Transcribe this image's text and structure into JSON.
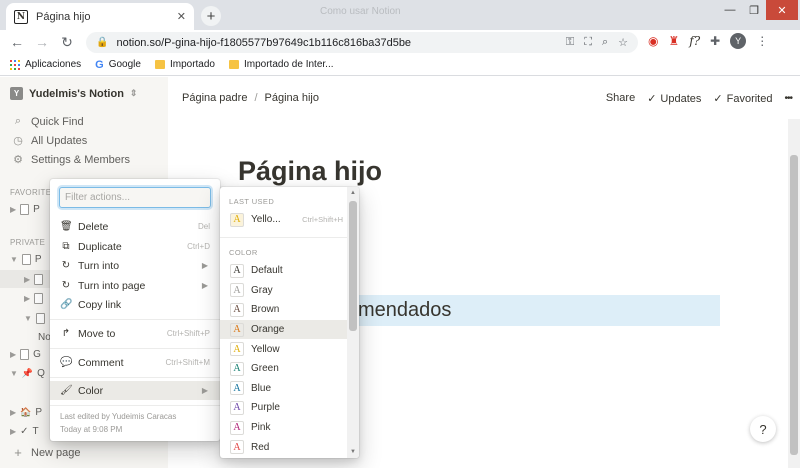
{
  "browser": {
    "tab_title": "Página hijo",
    "tab_favicon": "N",
    "tab_close": "✕",
    "new_tab": "+",
    "faint_text": "Como usar Notion",
    "url": "notion.so/P-gina-hijo-f1805577b97649c1b116c816ba37d5be",
    "win_min": "—",
    "win_max": "❐",
    "win_close": "✕",
    "avatar_letter": "Y",
    "bookmarks": [
      {
        "label": "Aplicaciones",
        "icon": "apps-icon"
      },
      {
        "label": "Google",
        "icon": "google-icon"
      },
      {
        "label": "Importado",
        "icon": "folder-icon"
      },
      {
        "label": "Importado de Inter...",
        "icon": "folder-icon"
      }
    ]
  },
  "sidebar": {
    "workspace": "Yudelmis's Notion",
    "workspace_letter": "Y",
    "items": [
      {
        "label": "Quick Find",
        "icon": "search-icon"
      },
      {
        "label": "All Updates",
        "icon": "clock-icon"
      },
      {
        "label": "Settings & Members",
        "icon": "gear-icon"
      }
    ],
    "favorites_label": "FAVORITES",
    "private_label": "PRIVATE",
    "row_letters": [
      "P",
      "P",
      "G",
      "Q",
      "P",
      "T"
    ],
    "row_trunc": "No",
    "new_page": "New page"
  },
  "topbar": {
    "crumb_parent": "Página padre",
    "crumb_sep": "/",
    "crumb_child": "Página hijo",
    "share": "Share",
    "updates": "Updates",
    "favorited": "Favorited",
    "more": "•••"
  },
  "page": {
    "title": "Página hijo",
    "callout_text": "mendados",
    "help": "?"
  },
  "menu": {
    "filter_placeholder": "Filter actions...",
    "items": [
      {
        "label": "Delete",
        "shortcut": "Del",
        "icon": "trash-icon"
      },
      {
        "label": "Duplicate",
        "shortcut": "Ctrl+D",
        "icon": "duplicate-icon"
      },
      {
        "label": "Turn into",
        "shortcut": "",
        "icon": "turn-into-icon"
      },
      {
        "label": "Turn into page",
        "shortcut": "",
        "icon": "turn-into-page-icon"
      },
      {
        "label": "Copy link",
        "shortcut": "",
        "icon": "link-icon"
      },
      {
        "label": "Move to",
        "shortcut": "Ctrl+Shift+P",
        "icon": "move-icon"
      },
      {
        "label": "Comment",
        "shortcut": "Ctrl+Shift+M",
        "icon": "comment-icon"
      },
      {
        "label": "Color",
        "shortcut": "",
        "icon": "paint-roller-icon"
      }
    ],
    "edited_by": "Last edited by Yudeimis Caracas",
    "edited_at": "Today at 9:08 PM"
  },
  "color_menu": {
    "last_used_label": "LAST USED",
    "last_used": {
      "label": "Yello...",
      "shortcut": "Ctrl+Shift+H",
      "color": "#dfab01",
      "bg": "#fbf3db"
    },
    "color_label": "COLOR",
    "colors": [
      {
        "label": "Default",
        "color": "#37352f"
      },
      {
        "label": "Gray",
        "color": "#9b9a97"
      },
      {
        "label": "Brown",
        "color": "#64473a"
      },
      {
        "label": "Orange",
        "color": "#d9730d"
      },
      {
        "label": "Yellow",
        "color": "#dfab01"
      },
      {
        "label": "Green",
        "color": "#0f7b6c"
      },
      {
        "label": "Blue",
        "color": "#0b6e99"
      },
      {
        "label": "Purple",
        "color": "#6940a5"
      },
      {
        "label": "Pink",
        "color": "#ad1a72"
      },
      {
        "label": "Red",
        "color": "#e03e3e"
      }
    ],
    "letter": "A",
    "selected": "Orange"
  }
}
